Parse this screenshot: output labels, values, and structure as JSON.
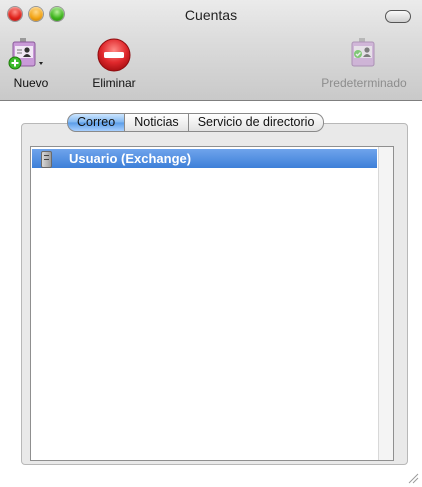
{
  "window": {
    "title": "Cuentas"
  },
  "toolbar": {
    "new_label": "Nuevo",
    "delete_label": "Eliminar",
    "default_label": "Predeterminado"
  },
  "tabs": [
    {
      "label": "Correo",
      "active": true
    },
    {
      "label": "Noticias",
      "active": false
    },
    {
      "label": "Servicio de directorio",
      "active": false
    }
  ],
  "accounts": [
    {
      "label": "Usuario (Exchange)",
      "selected": true,
      "icon": "server-icon"
    }
  ],
  "colors": {
    "selection": "#3d7fd8",
    "delete_button": "#e0282c",
    "new_badge": "#3bbb2a"
  }
}
